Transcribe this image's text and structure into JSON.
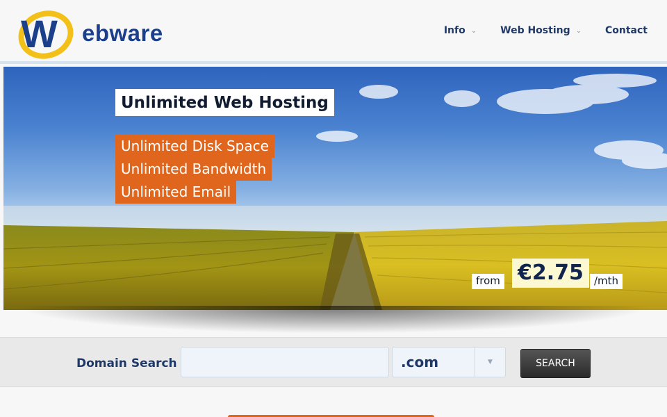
{
  "header": {
    "logo_text": "ebware",
    "logo_letter": "W",
    "nav": [
      {
        "label": "Info",
        "has_dropdown": true
      },
      {
        "label": "Web Hosting",
        "has_dropdown": true
      },
      {
        "label": "Contact",
        "has_dropdown": false
      }
    ]
  },
  "hero": {
    "title": "Unlimited Web Hosting",
    "features": [
      "Unlimited Disk Space",
      "Unlimited Bandwidth",
      "Unlimited Email"
    ],
    "price_prefix": "from",
    "price": "€2.75",
    "price_suffix": "/mth"
  },
  "domain_search": {
    "label": "Domain Search",
    "input_value": "",
    "input_placeholder": "",
    "tld_selected": ".com",
    "button_label": "SEARCH"
  },
  "colors": {
    "brand_blue": "#1c3f8c",
    "accent_orange": "#e0661d",
    "logo_yellow": "#f2c019"
  },
  "icons": [
    "chevron-down-icon",
    "dropdown-arrow-icon"
  ]
}
